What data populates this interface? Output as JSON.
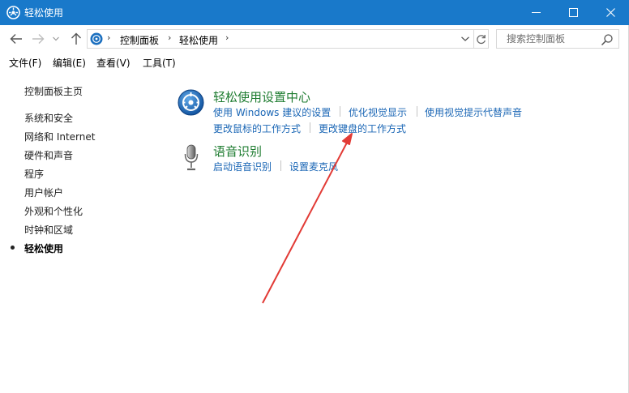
{
  "window": {
    "title": "轻松使用",
    "titlebar_color": "#1979ca",
    "app_icon": "ease-of-access-icon",
    "controls": [
      "minimize-icon",
      "maximize-icon",
      "close-icon"
    ]
  },
  "navigation": {
    "back_icon": "arrow-left-icon",
    "forward_icon": "arrow-right-icon",
    "history_icon": "chevron-down-icon",
    "up_icon": "arrow-up-icon",
    "breadcrumbs": [
      "控制面板",
      "轻松使用"
    ],
    "search_placeholder": "搜索控制面板"
  },
  "menubar": {
    "items": [
      "文件(F)",
      "编辑(E)",
      "查看(V)",
      "工具(T)"
    ]
  },
  "sidebar": {
    "items": [
      {
        "label": "控制面板主页",
        "active": false
      },
      {
        "label": "系统和安全",
        "active": false
      },
      {
        "label": "网络和 Internet",
        "active": false
      },
      {
        "label": "硬件和声音",
        "active": false
      },
      {
        "label": "程序",
        "active": false
      },
      {
        "label": "用户帐户",
        "active": false
      },
      {
        "label": "外观和个性化",
        "active": false
      },
      {
        "label": "时钟和区域",
        "active": false
      },
      {
        "label": "轻松使用",
        "active": true
      }
    ]
  },
  "main": {
    "sections": [
      {
        "title": "轻松使用设置中心",
        "icon": "ease-of-access-center-icon",
        "links": [
          "使用 Windows 建议的设置",
          "优化视觉显示",
          "使用视觉提示代替声音",
          "更改鼠标的工作方式",
          "更改键盘的工作方式"
        ]
      },
      {
        "title": "语音识别",
        "icon": "microphone-icon",
        "links": [
          "启动语音识别",
          "设置麦克风"
        ]
      }
    ]
  },
  "colors": {
    "section_title": "#1e7c30",
    "link": "#1a66b5",
    "annotation_arrow": "#e23b36"
  }
}
